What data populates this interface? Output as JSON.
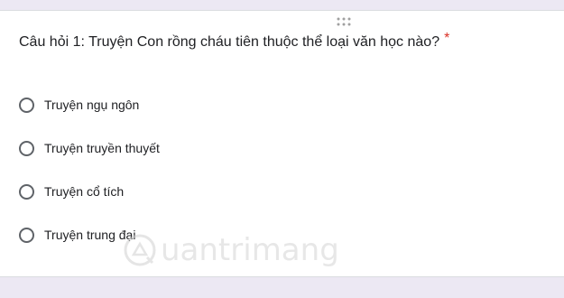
{
  "question": {
    "title": "Câu hỏi 1: Truyện Con rồng cháu tiên thuộc thể loại văn học nào?",
    "required_marker": "*"
  },
  "options": [
    {
      "label": "Truyện ngụ ngôn",
      "selected": false
    },
    {
      "label": "Truyện truyền thuyết",
      "selected": false
    },
    {
      "label": "Truyện cổ tích",
      "selected": false
    },
    {
      "label": "Truyện trung đại",
      "selected": false
    }
  ],
  "watermark": {
    "text": "uantrimang"
  },
  "icons": {
    "drag_handle": "drag-handle-icon",
    "watermark_logo": "quantrimang-logo-icon"
  },
  "colors": {
    "background": "#ece8f3",
    "card": "#ffffff",
    "required": "#d93025",
    "radio_border": "#5f6368"
  }
}
